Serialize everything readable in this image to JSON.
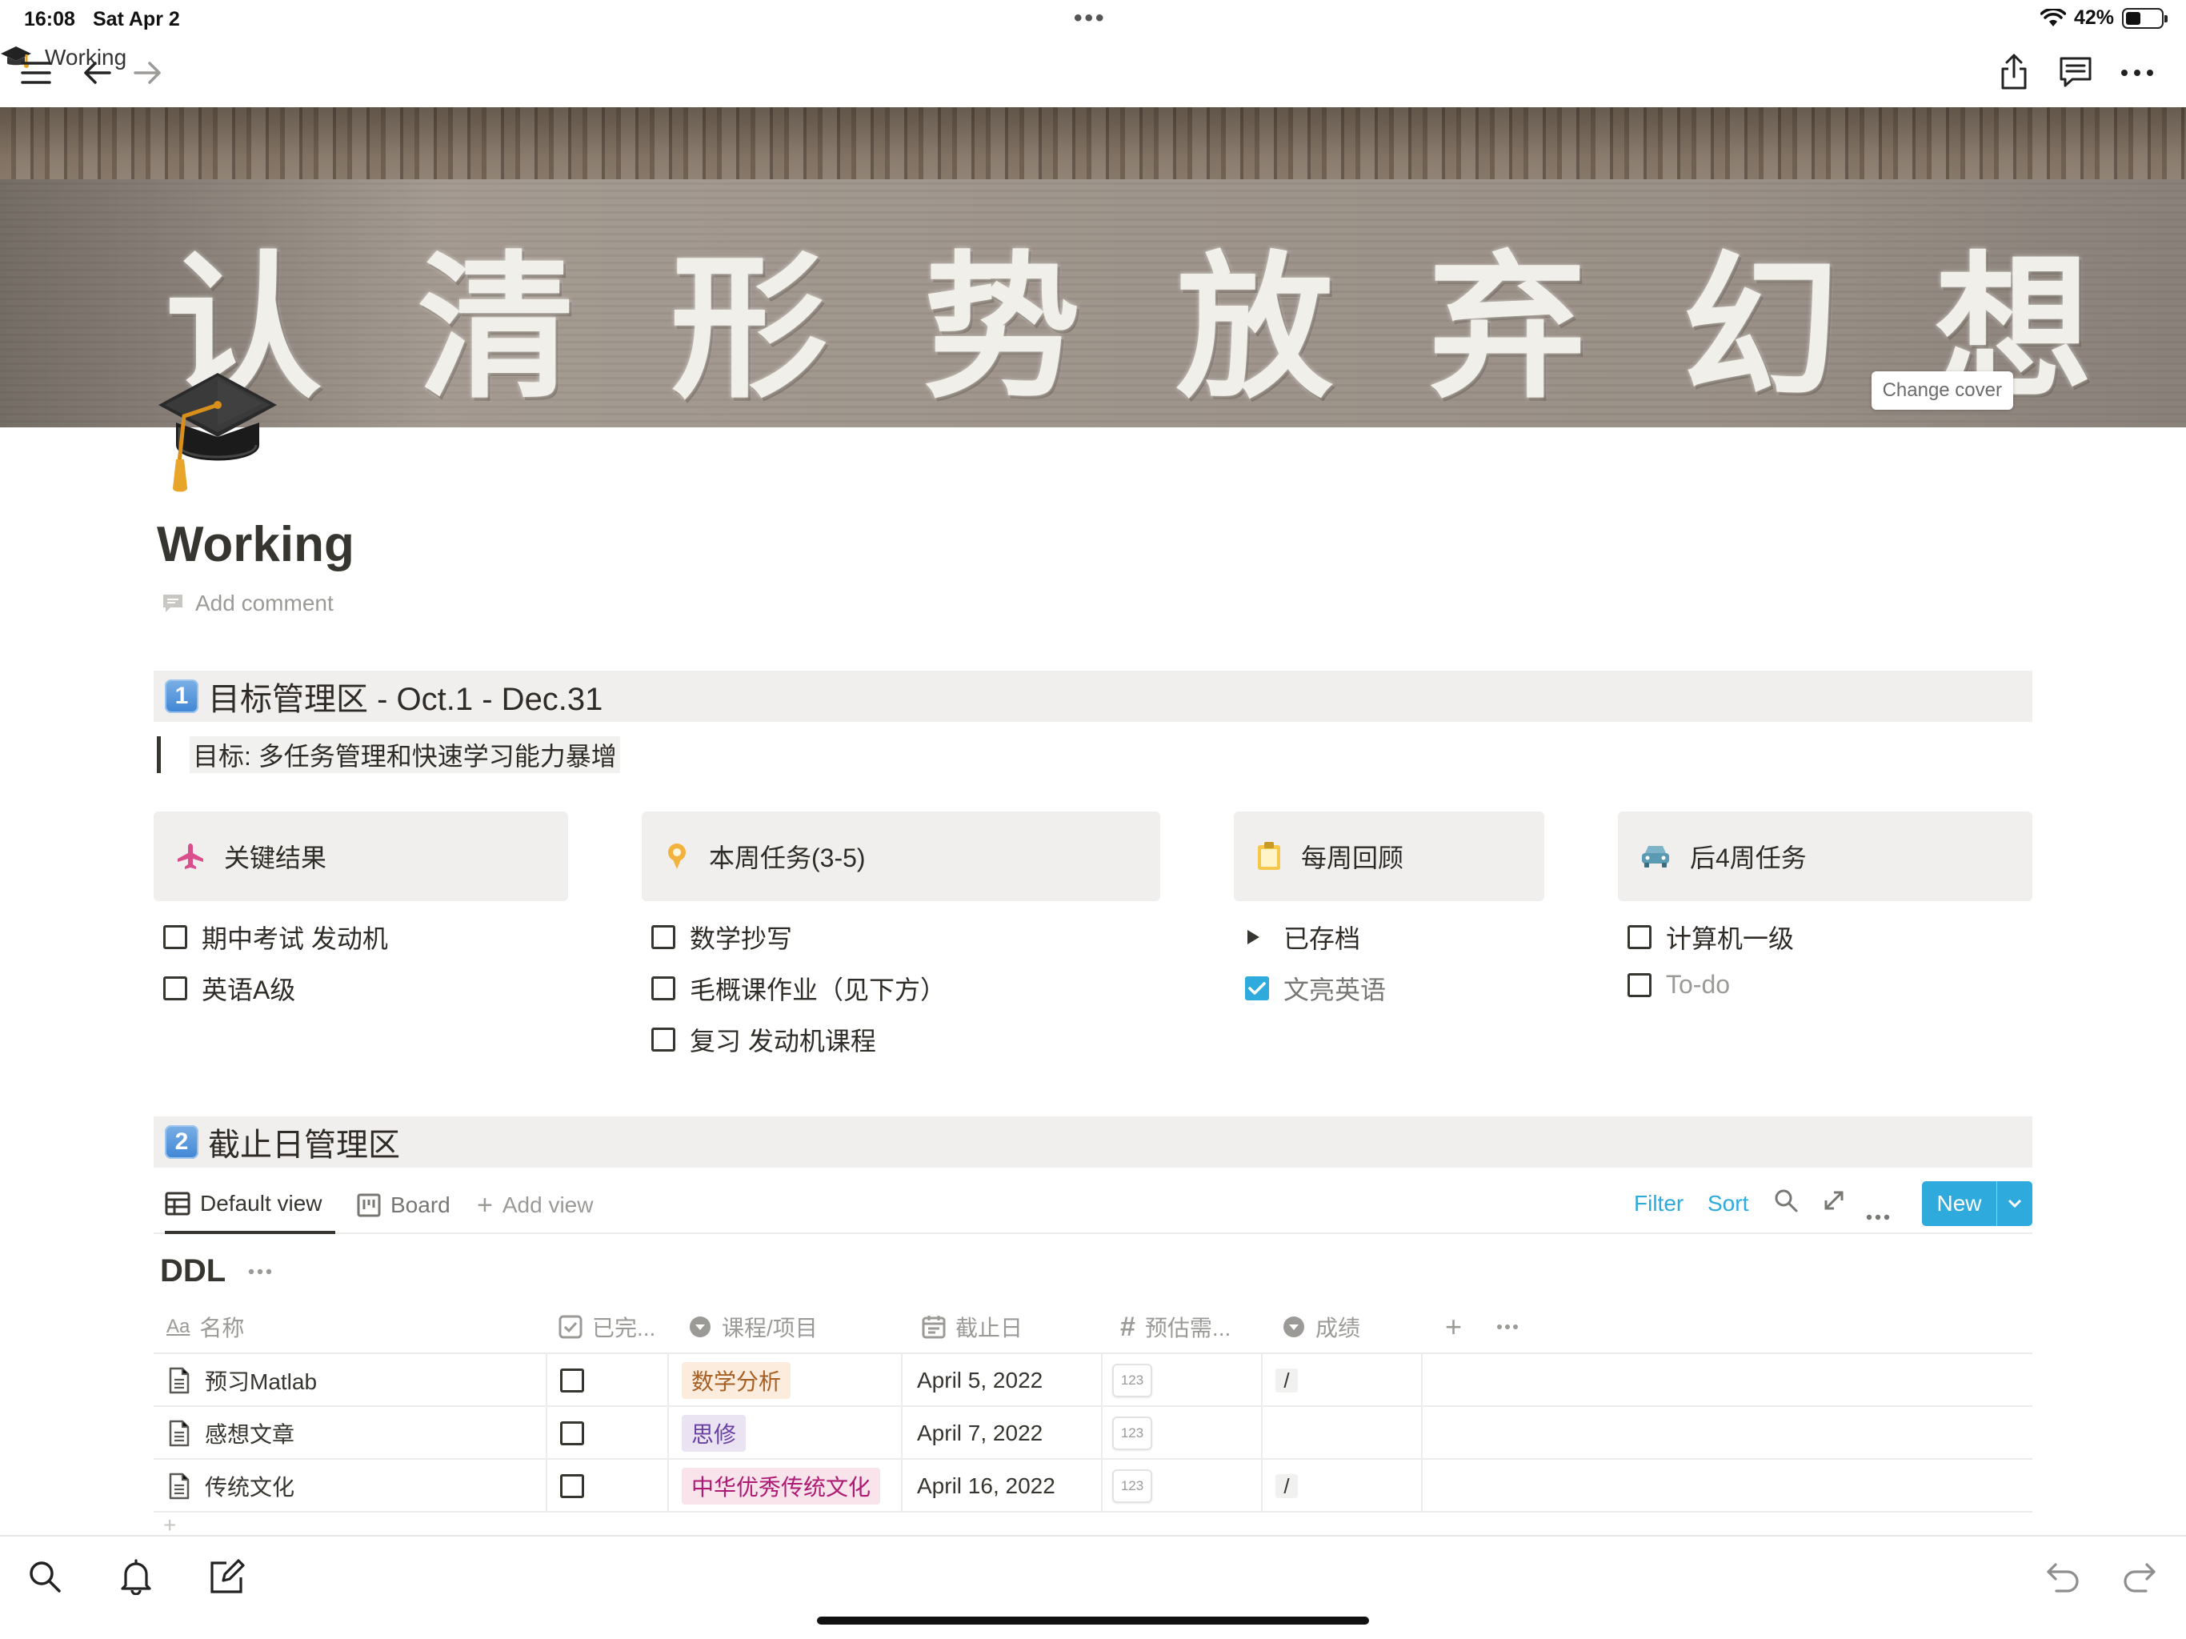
{
  "status": {
    "time": "16:08",
    "date": "Sat Apr 2",
    "battery": "42%",
    "battery_level": 0.42
  },
  "nav": {
    "title": "Working"
  },
  "cover": {
    "slogan": [
      "认",
      "清",
      "形",
      "势",
      "放",
      "弃",
      "幻",
      "想"
    ],
    "change_label": "Change cover"
  },
  "page": {
    "title": "Working",
    "add_comment": "Add comment"
  },
  "section1": {
    "number": "1",
    "title": "目标管理区 - Oct.1  - Dec.31",
    "quote": "目标: 多任务管理和快速学习能力暴增"
  },
  "columns": [
    {
      "title": "关键结果",
      "icon": "airplane-icon",
      "items": [
        {
          "text": "期中考试 发动机",
          "checked": false
        },
        {
          "text": "英语A级",
          "checked": false
        }
      ]
    },
    {
      "title": "本周任务(3-5)",
      "icon": "pin-icon",
      "items": [
        {
          "text": "数学抄写",
          "checked": false
        },
        {
          "text": "毛概课作业（见下方）",
          "checked": false
        },
        {
          "text": "复习 发动机课程",
          "checked": false
        }
      ]
    },
    {
      "title": "每周回顾",
      "icon": "clipboard-icon",
      "toggle": "已存档",
      "items": [
        {
          "text": "文亮英语",
          "checked": true
        }
      ]
    },
    {
      "title": "后4周任务",
      "icon": "car-icon",
      "items": [
        {
          "text": "计算机一级",
          "checked": false
        },
        {
          "text": "To-do",
          "checked": false,
          "placeholder": true
        }
      ]
    }
  ],
  "section2": {
    "number": "2",
    "title": "截止日管理区"
  },
  "views": {
    "default": "Default view",
    "board": "Board",
    "add": "Add view",
    "filter": "Filter",
    "sort": "Sort",
    "new": "New"
  },
  "db": {
    "title": "DDL",
    "columns": [
      "名称",
      "已完...",
      "课程/项目",
      "截止日",
      "预估需...",
      "成绩"
    ],
    "rows": [
      {
        "name": "预习Matlab",
        "done": false,
        "course": "数学分析",
        "course_color": "#fbecdd",
        "course_text": "#a65f24",
        "date": "April 5, 2022",
        "est": "123",
        "grade": "/"
      },
      {
        "name": "感想文章",
        "done": false,
        "course": "思修",
        "course_color": "#eae4f2",
        "course_text": "#6940a5",
        "date": "April 7, 2022",
        "est": "123",
        "grade": ""
      },
      {
        "name": "传统文化",
        "done": false,
        "course": "中华优秀传统文化",
        "course_color": "#f9e4ec",
        "course_text": "#ad1a72",
        "date": "April 16, 2022",
        "est": "123",
        "grade": "/"
      }
    ]
  }
}
